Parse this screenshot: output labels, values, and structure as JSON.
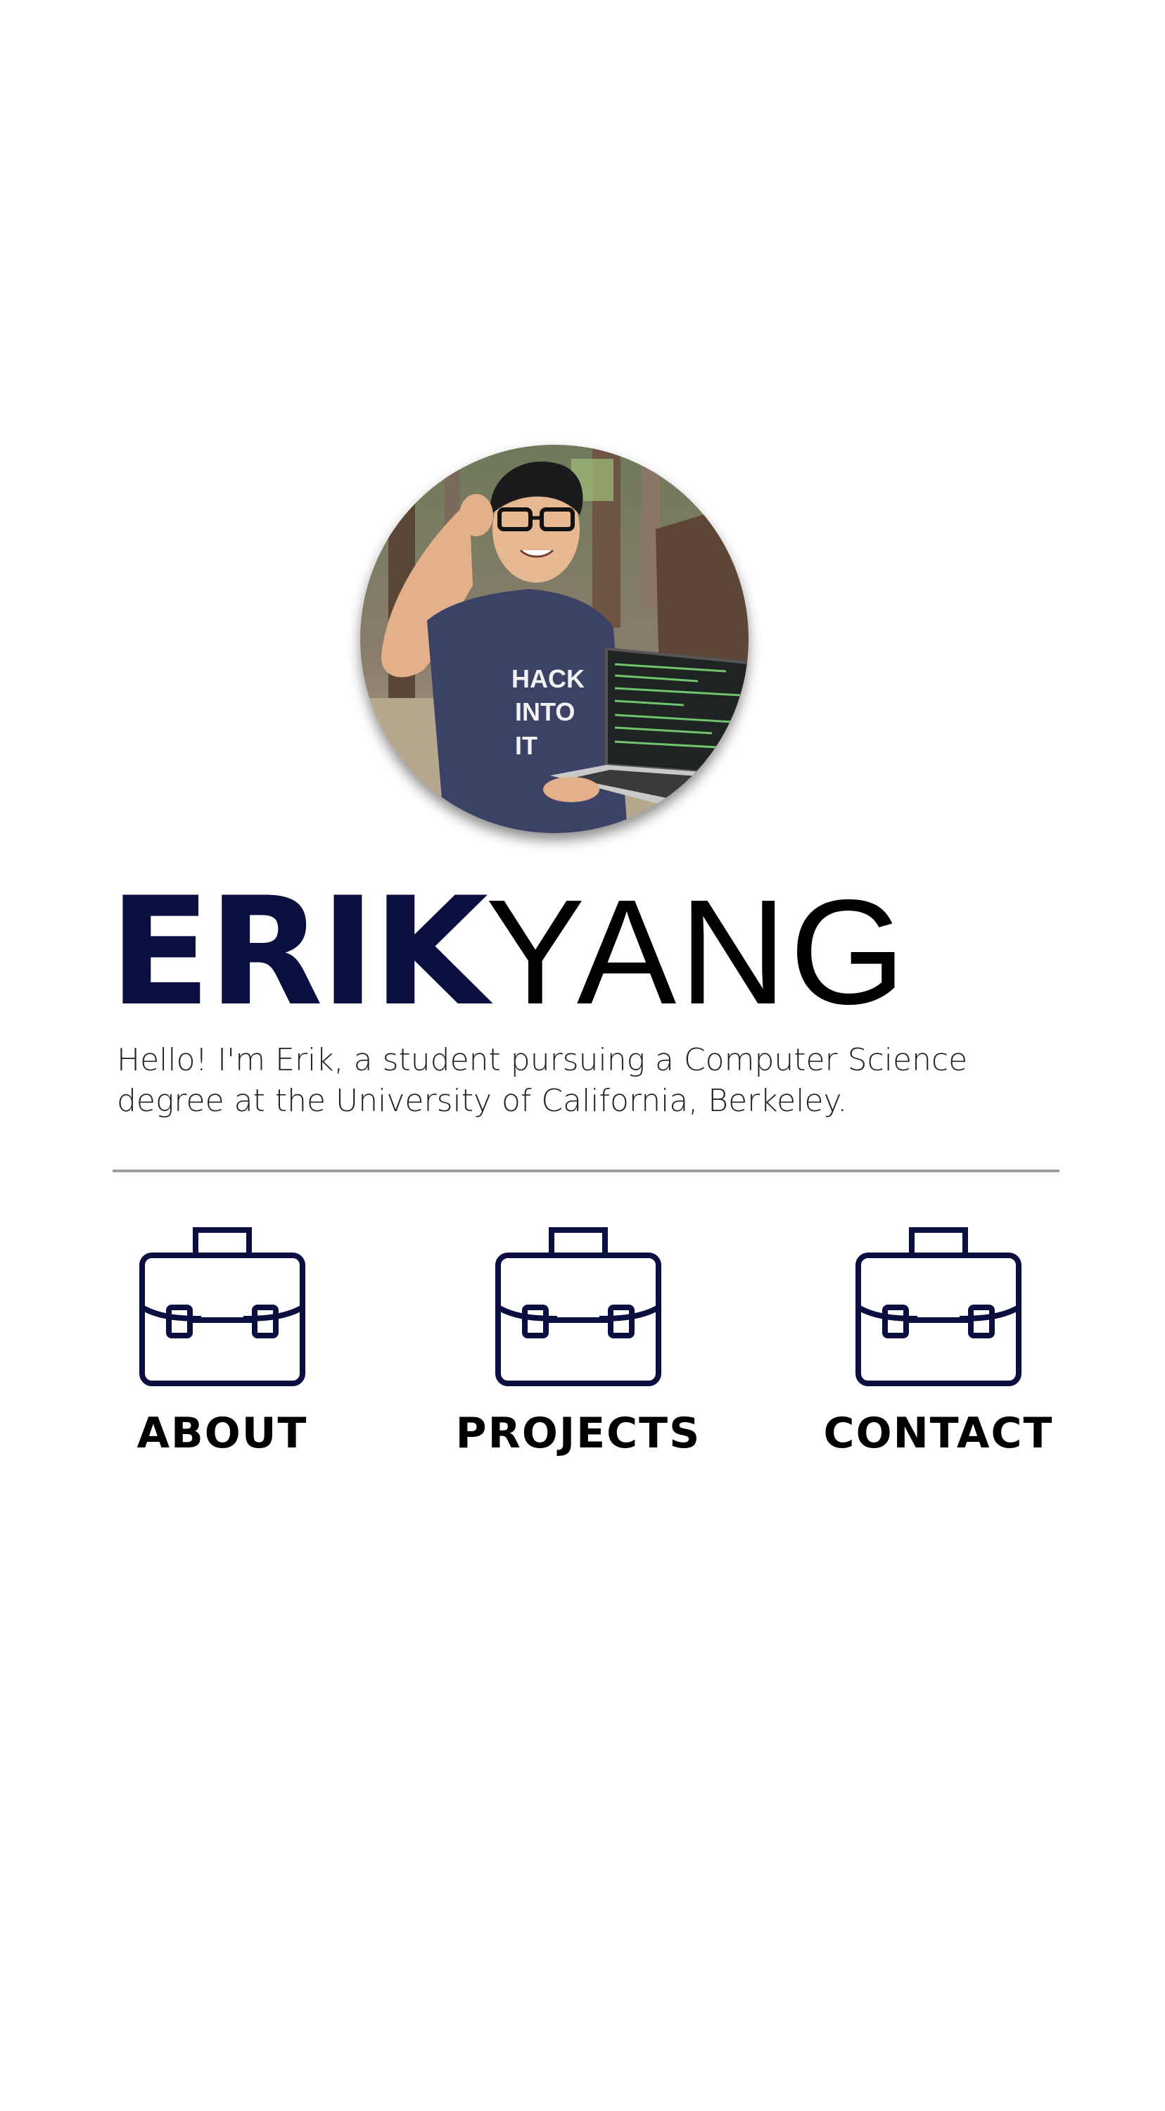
{
  "profile": {
    "first_name": "ERIK",
    "last_name": "YANG",
    "intro": "Hello! I'm Erik, a student pursuing a Computer Science degree at the University of California, Berkeley.",
    "photo": {
      "shirt_text": [
        "HACK",
        "INTO",
        "IT"
      ]
    }
  },
  "nav": {
    "items": [
      {
        "label": "ABOUT",
        "icon": "briefcase-icon"
      },
      {
        "label": "PROJECTS",
        "icon": "briefcase-icon"
      },
      {
        "label": "CONTACT",
        "icon": "briefcase-icon"
      }
    ]
  },
  "colors": {
    "navy": "#0b0f3f",
    "divider": "#9d9d9d",
    "background": "#ffffff"
  }
}
